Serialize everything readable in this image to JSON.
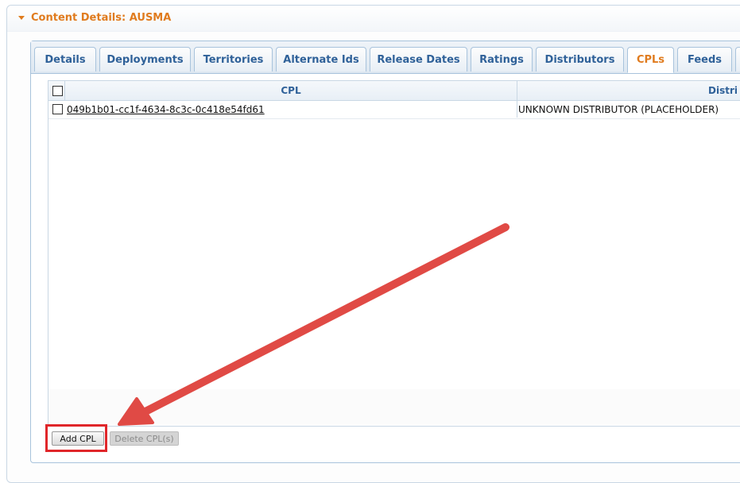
{
  "panel": {
    "title": "Content Details: AUSMA"
  },
  "tabs": [
    {
      "label": "Details",
      "active": false
    },
    {
      "label": "Deployments",
      "active": false
    },
    {
      "label": "Territories",
      "active": false
    },
    {
      "label": "Alternate Ids",
      "active": false
    },
    {
      "label": "Release Dates",
      "active": false
    },
    {
      "label": "Ratings",
      "active": false
    },
    {
      "label": "Distributors",
      "active": false
    },
    {
      "label": "CPLs",
      "active": true
    },
    {
      "label": "Feeds",
      "active": false
    }
  ],
  "grid": {
    "columns": [
      "CPL",
      "Distri"
    ],
    "rows": [
      {
        "cpl": "049b1b01-cc1f-4634-8c3c-0c418e54fd61",
        "distributor": "UNKNOWN DISTRIBUTOR (PLACEHOLDER)"
      }
    ]
  },
  "buttons": {
    "add": "Add CPL",
    "delete": "Delete CPL(s)"
  },
  "colors": {
    "accent": "#e07b1e",
    "tab_text": "#2f6199",
    "annotation": "#e0262a"
  }
}
